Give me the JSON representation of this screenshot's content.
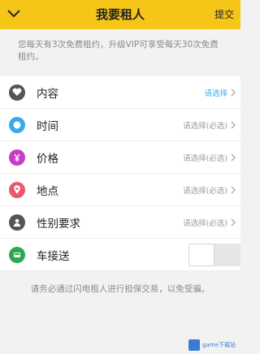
{
  "header": {
    "title": "我要租人",
    "submit_label": "提交"
  },
  "notice": "您每天有3次免费租约，升级VIP可享受每天30次免费租约。",
  "rows": [
    {
      "label": "内容",
      "value": "请选择",
      "icon": "heart-icon",
      "color": "#555555"
    },
    {
      "label": "时间",
      "value": "请选择(必选)",
      "icon": "clock-icon",
      "color": "#3aa8e8"
    },
    {
      "label": "价格",
      "value": "请选择(必选)",
      "icon": "yen-icon",
      "color": "#c83dc8"
    },
    {
      "label": "地点",
      "value": "请选择(必选)",
      "icon": "location-pin-icon",
      "color": "#e85a6a"
    },
    {
      "label": "性别要求",
      "value": "请选择(必选)",
      "icon": "person-icon",
      "color": "#555555"
    },
    {
      "label": "车接送",
      "icon": "car-icon",
      "color": "#2ca84f",
      "toggle_on": false
    }
  ],
  "footer": "请务必通过闪电租人进行担保交易，以免受骗。",
  "watermark": "game下载站",
  "colors": {
    "accent": "#f5c518",
    "background": "#f2f2f2",
    "hint_text": "#999999"
  }
}
